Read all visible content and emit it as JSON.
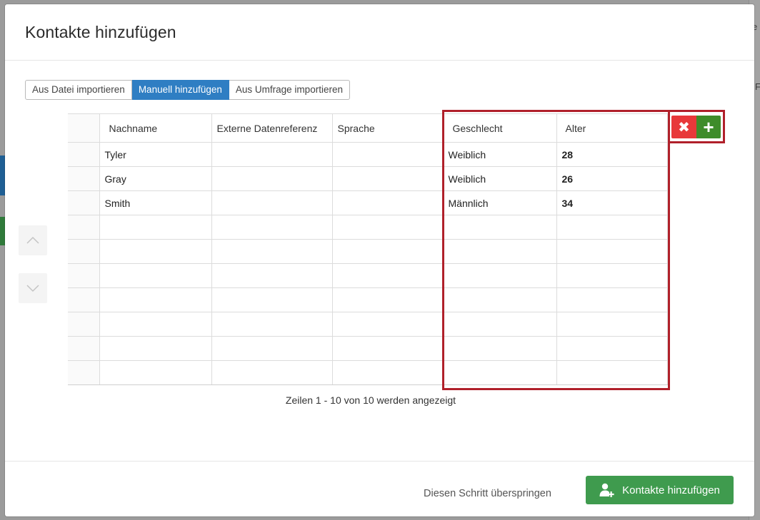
{
  "background": {
    "right_text_1": "e",
    "right_text_2": "F"
  },
  "modal": {
    "title": "Kontakte hinzufügen"
  },
  "tabs": [
    {
      "label": "Aus Datei importieren",
      "active": false
    },
    {
      "label": "Manuell hinzufügen",
      "active": true
    },
    {
      "label": "Aus Umfrage importieren",
      "active": false
    }
  ],
  "table": {
    "headers": {
      "nachname": "Nachname",
      "externe": "Externe Datenreferenz",
      "sprache": "Sprache",
      "geschlecht": "Geschlecht",
      "alter": "Alter"
    },
    "rows": [
      {
        "nachname": "Tyler",
        "externe": "",
        "sprache": "",
        "geschlecht": "Weiblich",
        "alter": "28"
      },
      {
        "nachname": "Gray",
        "externe": "",
        "sprache": "",
        "geschlecht": "Weiblich",
        "alter": "26"
      },
      {
        "nachname": "Smith",
        "externe": "",
        "sprache": "",
        "geschlecht": "Männlich",
        "alter": "34"
      },
      {
        "nachname": "",
        "externe": "",
        "sprache": "",
        "geschlecht": "",
        "alter": ""
      },
      {
        "nachname": "",
        "externe": "",
        "sprache": "",
        "geschlecht": "",
        "alter": ""
      },
      {
        "nachname": "",
        "externe": "",
        "sprache": "",
        "geschlecht": "",
        "alter": ""
      },
      {
        "nachname": "",
        "externe": "",
        "sprache": "",
        "geschlecht": "",
        "alter": ""
      },
      {
        "nachname": "",
        "externe": "",
        "sprache": "",
        "geschlecht": "",
        "alter": ""
      },
      {
        "nachname": "",
        "externe": "",
        "sprache": "",
        "geschlecht": "",
        "alter": ""
      },
      {
        "nachname": "",
        "externe": "",
        "sprache": "",
        "geschlecht": "",
        "alter": ""
      }
    ],
    "status": "Zeilen 1 - 10 von 10 werden angezeigt"
  },
  "column_buttons": {
    "remove_icon": "close-icon",
    "add_icon": "plus-icon"
  },
  "footer": {
    "skip_label": "Diesen Schritt überspringen",
    "submit_label": "Kontakte hinzufügen",
    "submit_icon": "user-plus-icon"
  },
  "colors": {
    "accent_blue": "#2f7ec3",
    "highlight_red": "#b0202a",
    "remove_red": "#e8383a",
    "add_green": "#3e8c2a",
    "primary_green": "#3f9b4e"
  }
}
